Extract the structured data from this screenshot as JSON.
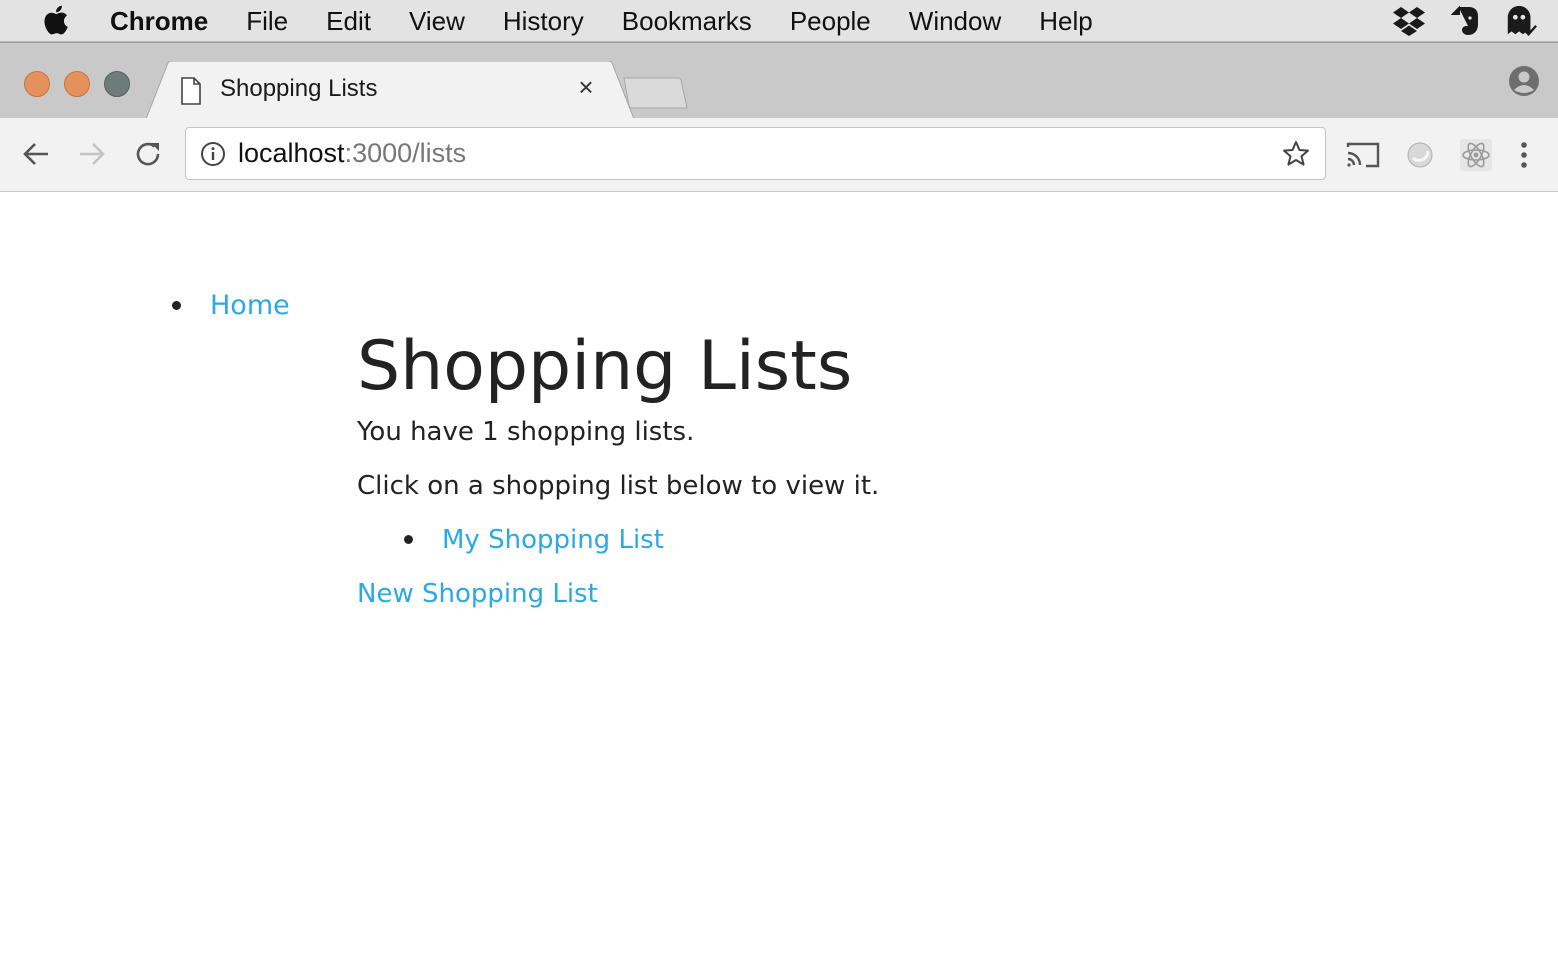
{
  "menubar": {
    "app": "Chrome",
    "items": [
      "File",
      "Edit",
      "View",
      "History",
      "Bookmarks",
      "People",
      "Window",
      "Help"
    ]
  },
  "tray": [
    "dropbox-icon",
    "evernote-icon",
    "ghost-icon"
  ],
  "tab": {
    "title": "Shopping Lists",
    "close": "×"
  },
  "address_bar": {
    "host": "localhost",
    "path": ":3000/lists"
  },
  "page": {
    "nav": [
      "Home"
    ],
    "heading": "Shopping Lists",
    "count_text": "You have 1 shopping lists.",
    "instruction": "Click on a shopping list below to view it.",
    "lists": [
      "My Shopping List"
    ],
    "new_link": "New Shopping List"
  },
  "colors": {
    "link": "#2ca8e6",
    "text": "#222222",
    "traffic_close": "#e5915b",
    "traffic_min": "#e5915b",
    "traffic_max": "#6e7c79"
  }
}
